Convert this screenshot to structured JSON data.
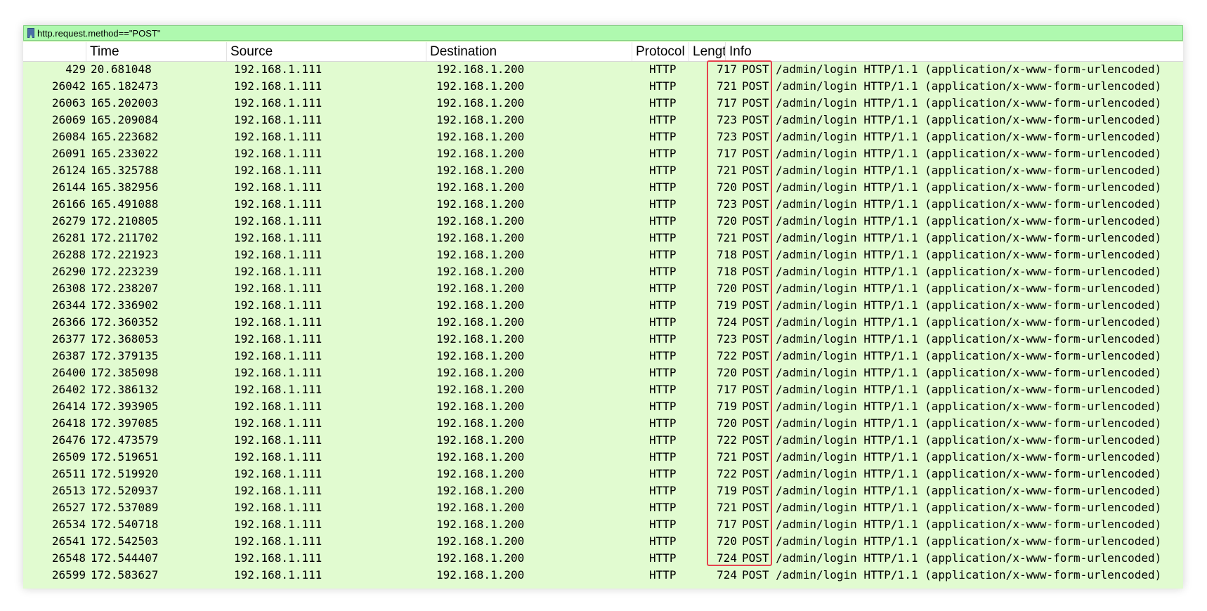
{
  "filter": {
    "value": "http.request.method==\"POST\"",
    "icon": "bookmark-icon"
  },
  "columns": {
    "no": "",
    "time": "Time",
    "source": "Source",
    "destination": "Destination",
    "protocol": "Protocol",
    "length": "Lengt",
    "info": "Info"
  },
  "colors": {
    "row_background": "#e1fbd0",
    "filter_background": "#aff9af",
    "highlight_border": "#e5424d"
  },
  "packets": [
    {
      "no": "429",
      "time": "20.681048",
      "source": "192.168.1.111",
      "destination": "192.168.1.200",
      "protocol": "HTTP",
      "length": "717",
      "info": "POST /admin/login HTTP/1.1  (application/x-www-form-urlencoded)"
    },
    {
      "no": "26042",
      "time": "165.182473",
      "source": "192.168.1.111",
      "destination": "192.168.1.200",
      "protocol": "HTTP",
      "length": "721",
      "info": "POST /admin/login HTTP/1.1  (application/x-www-form-urlencoded)"
    },
    {
      "no": "26063",
      "time": "165.202003",
      "source": "192.168.1.111",
      "destination": "192.168.1.200",
      "protocol": "HTTP",
      "length": "717",
      "info": "POST /admin/login HTTP/1.1  (application/x-www-form-urlencoded)"
    },
    {
      "no": "26069",
      "time": "165.209084",
      "source": "192.168.1.111",
      "destination": "192.168.1.200",
      "protocol": "HTTP",
      "length": "723",
      "info": "POST /admin/login HTTP/1.1  (application/x-www-form-urlencoded)"
    },
    {
      "no": "26084",
      "time": "165.223682",
      "source": "192.168.1.111",
      "destination": "192.168.1.200",
      "protocol": "HTTP",
      "length": "723",
      "info": "POST /admin/login HTTP/1.1  (application/x-www-form-urlencoded)"
    },
    {
      "no": "26091",
      "time": "165.233022",
      "source": "192.168.1.111",
      "destination": "192.168.1.200",
      "protocol": "HTTP",
      "length": "717",
      "info": "POST /admin/login HTTP/1.1  (application/x-www-form-urlencoded)"
    },
    {
      "no": "26124",
      "time": "165.325788",
      "source": "192.168.1.111",
      "destination": "192.168.1.200",
      "protocol": "HTTP",
      "length": "721",
      "info": "POST /admin/login HTTP/1.1  (application/x-www-form-urlencoded)"
    },
    {
      "no": "26144",
      "time": "165.382956",
      "source": "192.168.1.111",
      "destination": "192.168.1.200",
      "protocol": "HTTP",
      "length": "720",
      "info": "POST /admin/login HTTP/1.1  (application/x-www-form-urlencoded)"
    },
    {
      "no": "26166",
      "time": "165.491088",
      "source": "192.168.1.111",
      "destination": "192.168.1.200",
      "protocol": "HTTP",
      "length": "723",
      "info": "POST /admin/login HTTP/1.1  (application/x-www-form-urlencoded)"
    },
    {
      "no": "26279",
      "time": "172.210805",
      "source": "192.168.1.111",
      "destination": "192.168.1.200",
      "protocol": "HTTP",
      "length": "720",
      "info": "POST /admin/login HTTP/1.1  (application/x-www-form-urlencoded)"
    },
    {
      "no": "26281",
      "time": "172.211702",
      "source": "192.168.1.111",
      "destination": "192.168.1.200",
      "protocol": "HTTP",
      "length": "721",
      "info": "POST /admin/login HTTP/1.1  (application/x-www-form-urlencoded)"
    },
    {
      "no": "26288",
      "time": "172.221923",
      "source": "192.168.1.111",
      "destination": "192.168.1.200",
      "protocol": "HTTP",
      "length": "718",
      "info": "POST /admin/login HTTP/1.1  (application/x-www-form-urlencoded)"
    },
    {
      "no": "26290",
      "time": "172.223239",
      "source": "192.168.1.111",
      "destination": "192.168.1.200",
      "protocol": "HTTP",
      "length": "718",
      "info": "POST /admin/login HTTP/1.1  (application/x-www-form-urlencoded)"
    },
    {
      "no": "26308",
      "time": "172.238207",
      "source": "192.168.1.111",
      "destination": "192.168.1.200",
      "protocol": "HTTP",
      "length": "720",
      "info": "POST /admin/login HTTP/1.1  (application/x-www-form-urlencoded)"
    },
    {
      "no": "26344",
      "time": "172.336902",
      "source": "192.168.1.111",
      "destination": "192.168.1.200",
      "protocol": "HTTP",
      "length": "719",
      "info": "POST /admin/login HTTP/1.1  (application/x-www-form-urlencoded)"
    },
    {
      "no": "26366",
      "time": "172.360352",
      "source": "192.168.1.111",
      "destination": "192.168.1.200",
      "protocol": "HTTP",
      "length": "724",
      "info": "POST /admin/login HTTP/1.1  (application/x-www-form-urlencoded)"
    },
    {
      "no": "26377",
      "time": "172.368053",
      "source": "192.168.1.111",
      "destination": "192.168.1.200",
      "protocol": "HTTP",
      "length": "723",
      "info": "POST /admin/login HTTP/1.1  (application/x-www-form-urlencoded)"
    },
    {
      "no": "26387",
      "time": "172.379135",
      "source": "192.168.1.111",
      "destination": "192.168.1.200",
      "protocol": "HTTP",
      "length": "722",
      "info": "POST /admin/login HTTP/1.1  (application/x-www-form-urlencoded)"
    },
    {
      "no": "26400",
      "time": "172.385098",
      "source": "192.168.1.111",
      "destination": "192.168.1.200",
      "protocol": "HTTP",
      "length": "720",
      "info": "POST /admin/login HTTP/1.1  (application/x-www-form-urlencoded)"
    },
    {
      "no": "26402",
      "time": "172.386132",
      "source": "192.168.1.111",
      "destination": "192.168.1.200",
      "protocol": "HTTP",
      "length": "717",
      "info": "POST /admin/login HTTP/1.1  (application/x-www-form-urlencoded)"
    },
    {
      "no": "26414",
      "time": "172.393905",
      "source": "192.168.1.111",
      "destination": "192.168.1.200",
      "protocol": "HTTP",
      "length": "719",
      "info": "POST /admin/login HTTP/1.1  (application/x-www-form-urlencoded)"
    },
    {
      "no": "26418",
      "time": "172.397085",
      "source": "192.168.1.111",
      "destination": "192.168.1.200",
      "protocol": "HTTP",
      "length": "720",
      "info": "POST /admin/login HTTP/1.1  (application/x-www-form-urlencoded)"
    },
    {
      "no": "26476",
      "time": "172.473579",
      "source": "192.168.1.111",
      "destination": "192.168.1.200",
      "protocol": "HTTP",
      "length": "722",
      "info": "POST /admin/login HTTP/1.1  (application/x-www-form-urlencoded)"
    },
    {
      "no": "26509",
      "time": "172.519651",
      "source": "192.168.1.111",
      "destination": "192.168.1.200",
      "protocol": "HTTP",
      "length": "721",
      "info": "POST /admin/login HTTP/1.1  (application/x-www-form-urlencoded)"
    },
    {
      "no": "26511",
      "time": "172.519920",
      "source": "192.168.1.111",
      "destination": "192.168.1.200",
      "protocol": "HTTP",
      "length": "722",
      "info": "POST /admin/login HTTP/1.1  (application/x-www-form-urlencoded)"
    },
    {
      "no": "26513",
      "time": "172.520937",
      "source": "192.168.1.111",
      "destination": "192.168.1.200",
      "protocol": "HTTP",
      "length": "719",
      "info": "POST /admin/login HTTP/1.1  (application/x-www-form-urlencoded)"
    },
    {
      "no": "26527",
      "time": "172.537089",
      "source": "192.168.1.111",
      "destination": "192.168.1.200",
      "protocol": "HTTP",
      "length": "721",
      "info": "POST /admin/login HTTP/1.1  (application/x-www-form-urlencoded)"
    },
    {
      "no": "26534",
      "time": "172.540718",
      "source": "192.168.1.111",
      "destination": "192.168.1.200",
      "protocol": "HTTP",
      "length": "717",
      "info": "POST /admin/login HTTP/1.1  (application/x-www-form-urlencoded)"
    },
    {
      "no": "26541",
      "time": "172.542503",
      "source": "192.168.1.111",
      "destination": "192.168.1.200",
      "protocol": "HTTP",
      "length": "720",
      "info": "POST /admin/login HTTP/1.1  (application/x-www-form-urlencoded)"
    },
    {
      "no": "26548",
      "time": "172.544407",
      "source": "192.168.1.111",
      "destination": "192.168.1.200",
      "protocol": "HTTP",
      "length": "724",
      "info": "POST /admin/login HTTP/1.1  (application/x-www-form-urlencoded)"
    },
    {
      "no": "26599",
      "time": "172.583627",
      "source": "192.168.1.111",
      "destination": "192.168.1.200",
      "protocol": "HTTP",
      "length": "724",
      "info": "POST /admin/login HTTP/1.1  (application/x-www-form-urlencoded)"
    }
  ]
}
